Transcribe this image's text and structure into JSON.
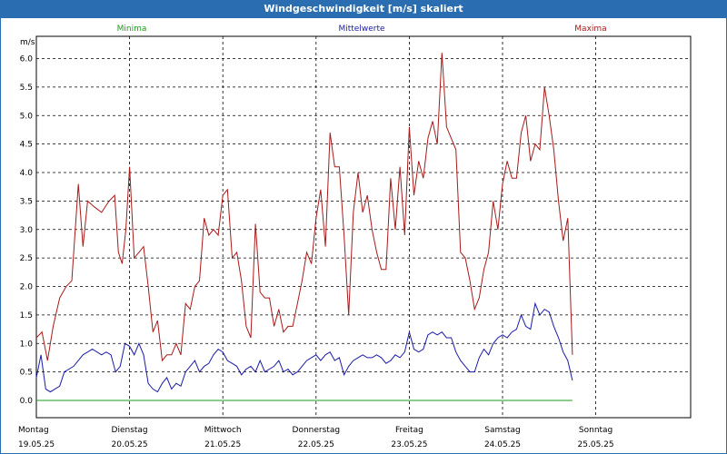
{
  "window": {
    "title": "Windgeschwindigkeit [m/s] skaliert"
  },
  "legend": {
    "minima": {
      "label": "Minima",
      "color": "#1a9a1a"
    },
    "mittelwerte": {
      "label": "Mittelwerte",
      "color": "#1a1aa8"
    },
    "maxima": {
      "label": "Maxima",
      "color": "#a81a1a"
    }
  },
  "chart_data": {
    "type": "line",
    "title": "Windgeschwindigkeit [m/s] skaliert",
    "ylabel": "m/s",
    "ylim": [
      0,
      6.4
    ],
    "yticks": [
      "0.0",
      "0.5",
      "1.0",
      "1.5",
      "2.0",
      "2.5",
      "3.0",
      "3.5",
      "4.0",
      "4.5",
      "5.0",
      "5.5",
      "6.0"
    ],
    "grid": true,
    "legend_position": "top",
    "x_day_labels": [
      {
        "day": "Montag",
        "date": "19.05.25"
      },
      {
        "day": "Dienstag",
        "date": "20.05.25"
      },
      {
        "day": "Mittwoch",
        "date": "21.05.25"
      },
      {
        "day": "Donnerstag",
        "date": "22.05.25"
      },
      {
        "day": "Freitag",
        "date": "23.05.25"
      },
      {
        "day": "Samstag",
        "date": "24.05.25"
      },
      {
        "day": "Sonntag",
        "date": "25.05.25"
      }
    ],
    "series": [
      {
        "name": "Maxima",
        "color": "#a81a1a",
        "points": [
          [
            0.0,
            1.1
          ],
          [
            0.06,
            1.2
          ],
          [
            0.12,
            0.7
          ],
          [
            0.18,
            1.3
          ],
          [
            0.25,
            1.8
          ],
          [
            0.32,
            2.0
          ],
          [
            0.38,
            2.1
          ],
          [
            0.45,
            3.8
          ],
          [
            0.5,
            2.7
          ],
          [
            0.55,
            3.5
          ],
          [
            0.62,
            3.4
          ],
          [
            0.7,
            3.3
          ],
          [
            0.78,
            3.5
          ],
          [
            0.84,
            3.6
          ],
          [
            0.88,
            2.6
          ],
          [
            0.92,
            2.4
          ],
          [
            0.96,
            3.0
          ],
          [
            1.0,
            4.1
          ],
          [
            1.05,
            2.5
          ],
          [
            1.1,
            2.6
          ],
          [
            1.15,
            2.7
          ],
          [
            1.2,
            2.0
          ],
          [
            1.25,
            1.2
          ],
          [
            1.3,
            1.4
          ],
          [
            1.35,
            0.7
          ],
          [
            1.4,
            0.8
          ],
          [
            1.45,
            0.8
          ],
          [
            1.5,
            1.0
          ],
          [
            1.55,
            0.8
          ],
          [
            1.6,
            1.7
          ],
          [
            1.65,
            1.6
          ],
          [
            1.7,
            2.0
          ],
          [
            1.75,
            2.1
          ],
          [
            1.8,
            3.2
          ],
          [
            1.85,
            2.9
          ],
          [
            1.9,
            3.0
          ],
          [
            1.95,
            2.9
          ],
          [
            2.0,
            3.6
          ],
          [
            2.05,
            3.7
          ],
          [
            2.1,
            2.5
          ],
          [
            2.15,
            2.6
          ],
          [
            2.2,
            2.1
          ],
          [
            2.25,
            1.3
          ],
          [
            2.3,
            1.1
          ],
          [
            2.35,
            3.1
          ],
          [
            2.4,
            1.9
          ],
          [
            2.45,
            1.8
          ],
          [
            2.5,
            1.8
          ],
          [
            2.55,
            1.3
          ],
          [
            2.6,
            1.6
          ],
          [
            2.65,
            1.2
          ],
          [
            2.7,
            1.3
          ],
          [
            2.75,
            1.3
          ],
          [
            2.8,
            1.7
          ],
          [
            2.85,
            2.1
          ],
          [
            2.9,
            2.6
          ],
          [
            2.95,
            2.4
          ],
          [
            3.0,
            3.2
          ],
          [
            3.05,
            3.7
          ],
          [
            3.1,
            2.7
          ],
          [
            3.15,
            4.7
          ],
          [
            3.2,
            4.1
          ],
          [
            3.25,
            4.1
          ],
          [
            3.3,
            2.9
          ],
          [
            3.35,
            1.5
          ],
          [
            3.4,
            3.3
          ],
          [
            3.45,
            4.0
          ],
          [
            3.5,
            3.3
          ],
          [
            3.55,
            3.6
          ],
          [
            3.6,
            3.0
          ],
          [
            3.65,
            2.6
          ],
          [
            3.7,
            2.3
          ],
          [
            3.75,
            2.3
          ],
          [
            3.8,
            3.9
          ],
          [
            3.85,
            3.0
          ],
          [
            3.9,
            4.1
          ],
          [
            3.95,
            2.9
          ],
          [
            4.0,
            4.8
          ],
          [
            4.05,
            3.6
          ],
          [
            4.1,
            4.2
          ],
          [
            4.15,
            3.9
          ],
          [
            4.2,
            4.6
          ],
          [
            4.25,
            4.9
          ],
          [
            4.3,
            4.5
          ],
          [
            4.35,
            6.1
          ],
          [
            4.4,
            4.8
          ],
          [
            4.45,
            4.6
          ],
          [
            4.5,
            4.4
          ],
          [
            4.55,
            2.6
          ],
          [
            4.6,
            2.5
          ],
          [
            4.65,
            2.1
          ],
          [
            4.7,
            1.6
          ],
          [
            4.75,
            1.8
          ],
          [
            4.8,
            2.3
          ],
          [
            4.85,
            2.6
          ],
          [
            4.9,
            3.5
          ],
          [
            4.95,
            3.0
          ],
          [
            5.0,
            3.8
          ],
          [
            5.05,
            4.2
          ],
          [
            5.1,
            3.9
          ],
          [
            5.15,
            3.9
          ],
          [
            5.2,
            4.7
          ],
          [
            5.25,
            5.0
          ],
          [
            5.3,
            4.2
          ],
          [
            5.35,
            4.5
          ],
          [
            5.4,
            4.4
          ],
          [
            5.45,
            5.5
          ],
          [
            5.5,
            5.0
          ],
          [
            5.55,
            4.4
          ],
          [
            5.6,
            3.5
          ],
          [
            5.65,
            2.8
          ],
          [
            5.7,
            3.2
          ],
          [
            5.75,
            0.8
          ]
        ]
      },
      {
        "name": "Mittelwerte",
        "color": "#1a1aa8",
        "points": [
          [
            0.0,
            0.4
          ],
          [
            0.05,
            0.8
          ],
          [
            0.1,
            0.2
          ],
          [
            0.15,
            0.15
          ],
          [
            0.2,
            0.2
          ],
          [
            0.25,
            0.25
          ],
          [
            0.3,
            0.5
          ],
          [
            0.35,
            0.55
          ],
          [
            0.4,
            0.6
          ],
          [
            0.45,
            0.7
          ],
          [
            0.5,
            0.8
          ],
          [
            0.55,
            0.85
          ],
          [
            0.6,
            0.9
          ],
          [
            0.7,
            0.8
          ],
          [
            0.75,
            0.85
          ],
          [
            0.8,
            0.8
          ],
          [
            0.85,
            0.5
          ],
          [
            0.9,
            0.6
          ],
          [
            0.95,
            1.0
          ],
          [
            1.0,
            0.95
          ],
          [
            1.05,
            0.8
          ],
          [
            1.1,
            1.0
          ],
          [
            1.15,
            0.8
          ],
          [
            1.2,
            0.3
          ],
          [
            1.25,
            0.2
          ],
          [
            1.3,
            0.15
          ],
          [
            1.35,
            0.3
          ],
          [
            1.4,
            0.4
          ],
          [
            1.45,
            0.2
          ],
          [
            1.5,
            0.3
          ],
          [
            1.55,
            0.25
          ],
          [
            1.6,
            0.5
          ],
          [
            1.65,
            0.6
          ],
          [
            1.7,
            0.7
          ],
          [
            1.75,
            0.5
          ],
          [
            1.8,
            0.6
          ],
          [
            1.85,
            0.65
          ],
          [
            1.9,
            0.8
          ],
          [
            1.95,
            0.9
          ],
          [
            2.0,
            0.85
          ],
          [
            2.05,
            0.7
          ],
          [
            2.1,
            0.65
          ],
          [
            2.15,
            0.6
          ],
          [
            2.2,
            0.45
          ],
          [
            2.25,
            0.55
          ],
          [
            2.3,
            0.6
          ],
          [
            2.35,
            0.5
          ],
          [
            2.4,
            0.7
          ],
          [
            2.45,
            0.5
          ],
          [
            2.5,
            0.55
          ],
          [
            2.55,
            0.6
          ],
          [
            2.6,
            0.7
          ],
          [
            2.65,
            0.5
          ],
          [
            2.7,
            0.55
          ],
          [
            2.75,
            0.45
          ],
          [
            2.8,
            0.5
          ],
          [
            2.85,
            0.6
          ],
          [
            2.9,
            0.7
          ],
          [
            2.95,
            0.75
          ],
          [
            3.0,
            0.8
          ],
          [
            3.05,
            0.7
          ],
          [
            3.1,
            0.8
          ],
          [
            3.15,
            0.85
          ],
          [
            3.2,
            0.7
          ],
          [
            3.25,
            0.75
          ],
          [
            3.3,
            0.45
          ],
          [
            3.35,
            0.6
          ],
          [
            3.4,
            0.7
          ],
          [
            3.45,
            0.75
          ],
          [
            3.5,
            0.8
          ],
          [
            3.55,
            0.75
          ],
          [
            3.6,
            0.75
          ],
          [
            3.65,
            0.8
          ],
          [
            3.7,
            0.75
          ],
          [
            3.75,
            0.65
          ],
          [
            3.8,
            0.7
          ],
          [
            3.85,
            0.8
          ],
          [
            3.9,
            0.75
          ],
          [
            3.95,
            0.85
          ],
          [
            4.0,
            1.2
          ],
          [
            4.05,
            0.9
          ],
          [
            4.1,
            0.85
          ],
          [
            4.15,
            0.9
          ],
          [
            4.2,
            1.15
          ],
          [
            4.25,
            1.2
          ],
          [
            4.3,
            1.15
          ],
          [
            4.35,
            1.2
          ],
          [
            4.4,
            1.1
          ],
          [
            4.45,
            1.1
          ],
          [
            4.5,
            0.85
          ],
          [
            4.55,
            0.7
          ],
          [
            4.6,
            0.6
          ],
          [
            4.65,
            0.5
          ],
          [
            4.7,
            0.5
          ],
          [
            4.75,
            0.75
          ],
          [
            4.8,
            0.9
          ],
          [
            4.85,
            0.8
          ],
          [
            4.9,
            1.0
          ],
          [
            4.95,
            1.1
          ],
          [
            5.0,
            1.15
          ],
          [
            5.05,
            1.1
          ],
          [
            5.1,
            1.2
          ],
          [
            5.15,
            1.25
          ],
          [
            5.2,
            1.5
          ],
          [
            5.25,
            1.3
          ],
          [
            5.3,
            1.25
          ],
          [
            5.35,
            1.7
          ],
          [
            5.4,
            1.5
          ],
          [
            5.45,
            1.6
          ],
          [
            5.5,
            1.55
          ],
          [
            5.55,
            1.3
          ],
          [
            5.6,
            1.1
          ],
          [
            5.65,
            0.85
          ],
          [
            5.7,
            0.7
          ],
          [
            5.75,
            0.35
          ]
        ]
      },
      {
        "name": "Minima",
        "color": "#1a9a1a",
        "points": [
          [
            0.0,
            0.0
          ],
          [
            5.75,
            0.0
          ]
        ]
      }
    ]
  }
}
